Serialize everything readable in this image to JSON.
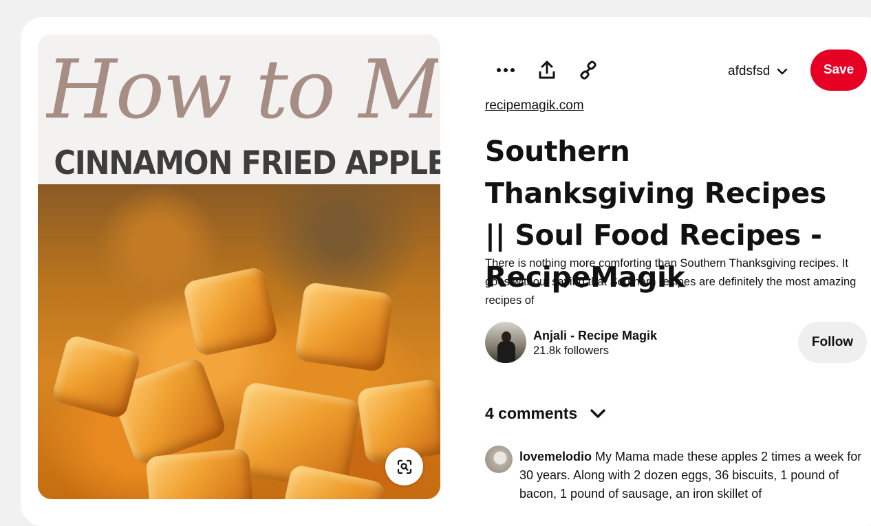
{
  "pin": {
    "image": {
      "script_text": "How to Make",
      "headline_text": "CINNAMON FRIED APPLES"
    },
    "toolbar": {
      "more_icon": "more-horizontal-icon",
      "share_icon": "share-upload-icon",
      "link_icon": "link-icon"
    },
    "board_select": {
      "value": "afdsfsd"
    },
    "save_label": "Save",
    "source_link": "recipemagik.com",
    "title": "Southern Thanksgiving Recipes || Soul Food Recipes - RecipeMagik",
    "description": "There is nothing more comforting than Southern Thanksgiving recipes. It goes without saying that Southern recipes are definitely the most amazing recipes of",
    "creator": {
      "name": "Anjali - Recipe Magik",
      "followers": "21.8k followers"
    },
    "follow_label": "Follow",
    "comments": {
      "count_label": "4 comments",
      "items": [
        {
          "user": "lovemelodio",
          "text": "My Mama made these apples 2 times a week for 30 years. Along with 2 dozen eggs, 36 biscuits, 1 pound of bacon, 1 pound of sausage, an iron skillet of"
        }
      ]
    }
  },
  "colors": {
    "save": "#e60023",
    "follow_bg": "#efefef",
    "card_bg": "#ffffff",
    "page_bg": "#f1f1f1"
  }
}
